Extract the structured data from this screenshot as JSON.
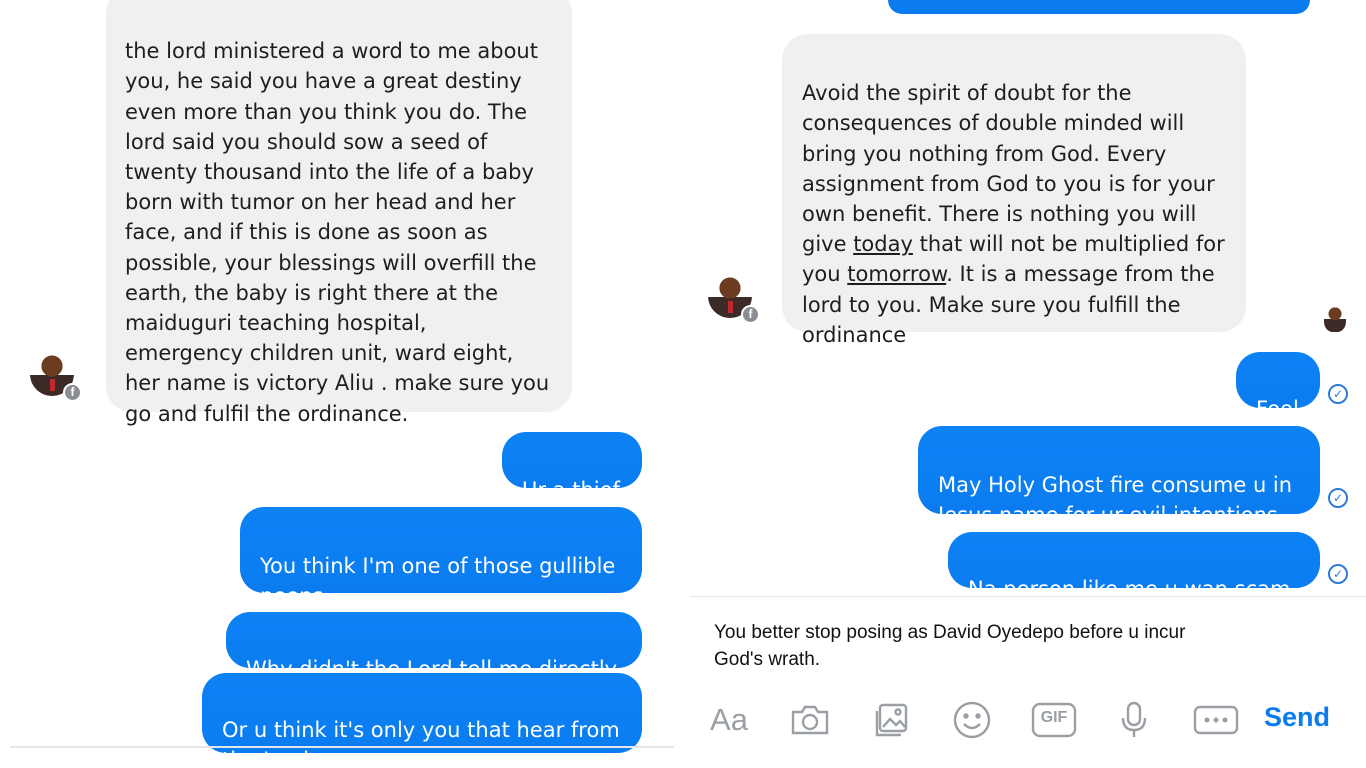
{
  "left": {
    "incoming_message": "the lord ministered a word to me about\nyou, he said you have a great destiny\neven more than you think you do. The\nlord said you should sow a seed of\ntwenty thousand into the life of a baby\nborn with tumor on her head and her\nface, and if this is done as soon as\npossible, your blessings will overfill the\nearth, the baby is right there at the\nmaiduguri teaching hospital,\nemergency children unit, ward eight,\nher name is victory Aliu . make sure you\ngo and fulfil the ordinance.",
    "outgoing": [
      "Ur a thief",
      "You think I'm one of those gullible\npeeps",
      "Why didn't the Lord tell me directly",
      "Or u think it's only you that hear from\nthe Lord"
    ]
  },
  "right": {
    "incoming_message_part1": "Avoid the spirit of doubt for the\nconsequences of double minded will\nbring you nothing from God. Every\nassignment from God to you is for your\nown benefit. There is nothing you will\ngive ",
    "underlined_1": "today",
    "incoming_message_part2": " that will not be multiplied for\nyou ",
    "underlined_2": "tomorrow",
    "incoming_message_part3": ". It is a message from the\nlord to you. Make sure you fulfill the\nordinance",
    "outgoing": [
      "Fool",
      "May Holy Ghost fire consume u in\nJesus name for ur evil intentions",
      "Na person like me u wan scam."
    ],
    "composer_text": "You better stop posing as David Oyedepo before u incur\nGod's wrath.",
    "composer_placeholder_icon": "Aa",
    "send_label": "Send",
    "toolbar_icons": [
      "camera-icon",
      "gallery-icon",
      "emoji-icon",
      "gif-icon",
      "microphone-icon",
      "more-icon"
    ],
    "gif_label": "GIF"
  },
  "colors": {
    "outgoing_bubble": "#0a7cf0",
    "incoming_bubble": "#f1f0f0",
    "send": "#0a7cf0",
    "seen_check": "#2f7bd6"
  }
}
